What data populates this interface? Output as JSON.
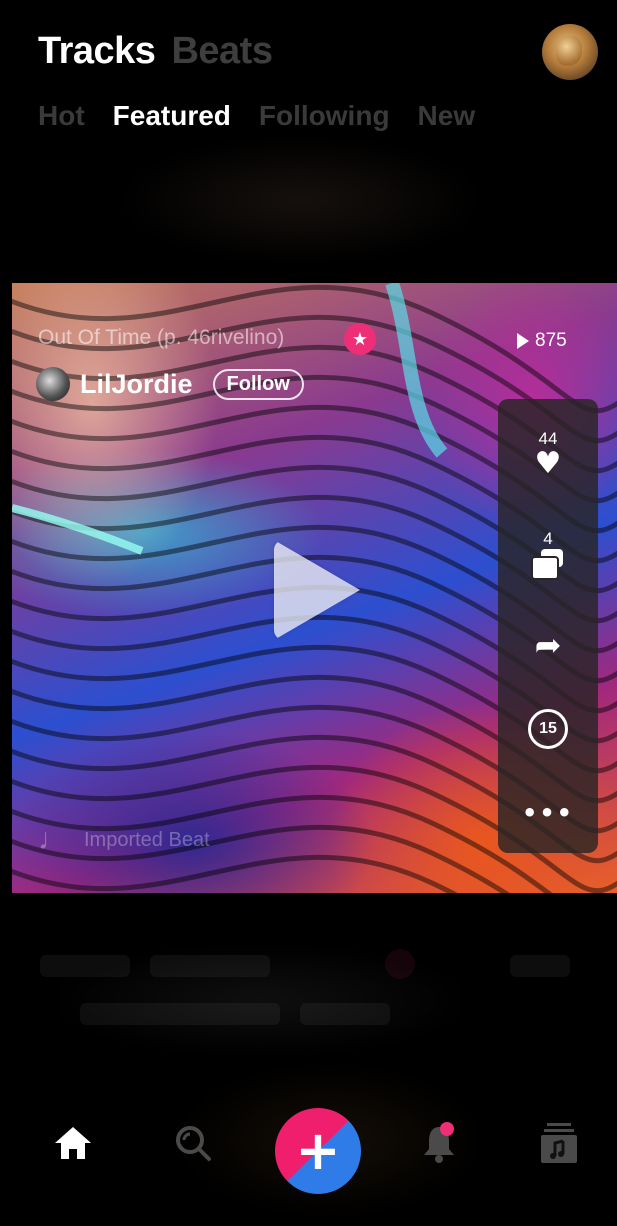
{
  "header": {
    "tabs": [
      {
        "label": "Tracks",
        "active": true
      },
      {
        "label": "Beats",
        "active": false
      }
    ],
    "avatar_icon": "user-avatar"
  },
  "subtabs": [
    {
      "label": "Hot",
      "active": false
    },
    {
      "label": "Featured",
      "active": true
    },
    {
      "label": "Following",
      "active": false
    },
    {
      "label": "New",
      "active": false
    }
  ],
  "track": {
    "title": "Out Of Time (p. 46rivelino)",
    "plays": "875",
    "artist": "LilJordie",
    "follow_label": "Follow",
    "source_label": "Imported Beat",
    "likes": "44",
    "comments": "4",
    "replay_seconds": "15",
    "badge_color": "#ee2f78"
  },
  "actions": {
    "like_icon": "heart-icon",
    "comment_icon": "comments-icon",
    "share_icon": "share-icon",
    "replay_icon": "replay-15-icon",
    "more_icon": "more-icon",
    "more_glyph": "•••"
  },
  "nav": {
    "home_icon": "home-icon",
    "search_icon": "search-icon",
    "create_glyph": "+",
    "create_colors": [
      "#f01f6e",
      "#2f7be8"
    ],
    "notifications_icon": "bell-icon",
    "library_icon": "music-library-icon"
  }
}
